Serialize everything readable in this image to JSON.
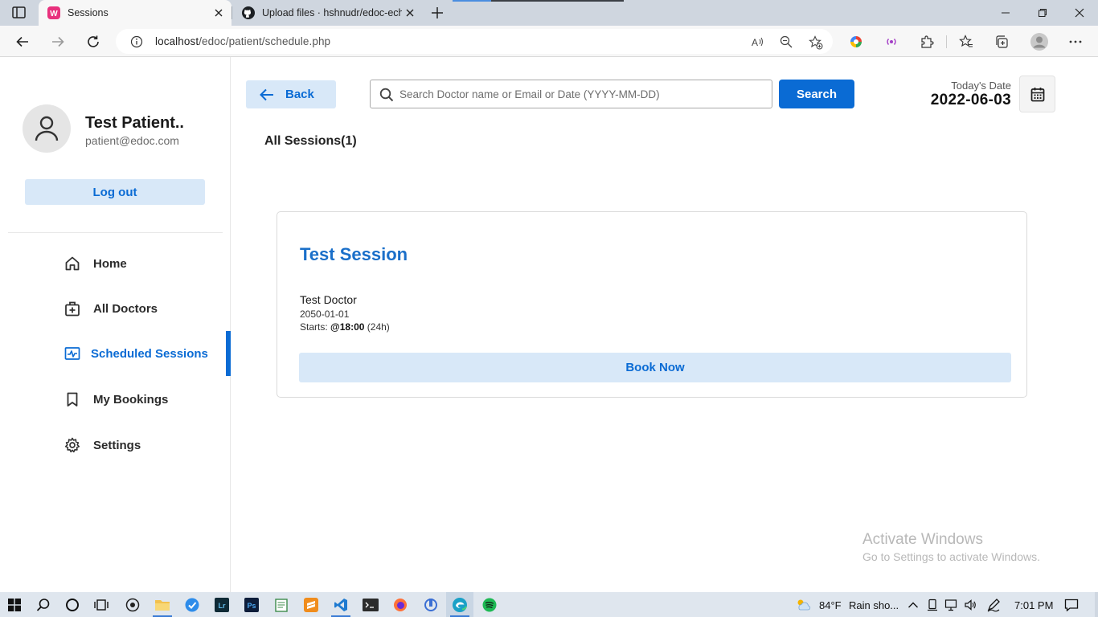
{
  "browser": {
    "tabs": [
      {
        "title": "Sessions",
        "favicon": "wamp-icon",
        "active": true
      },
      {
        "title": "Upload files · hshnudr/edoc-echa",
        "favicon": "github-icon",
        "active": false
      }
    ],
    "url_host": "localhost",
    "url_path": "/edoc/patient/schedule.php"
  },
  "sidebar": {
    "profile": {
      "name": "Test Patient..",
      "email": "patient@edoc.com"
    },
    "logout_label": "Log out",
    "items": [
      {
        "label": "Home",
        "icon": "home-icon"
      },
      {
        "label": "All Doctors",
        "icon": "doctor-bag-icon"
      },
      {
        "label": "Scheduled Sessions",
        "icon": "schedule-icon",
        "active": true
      },
      {
        "label": "My Bookings",
        "icon": "bookmark-icon"
      },
      {
        "label": "Settings",
        "icon": "gear-icon"
      }
    ]
  },
  "header": {
    "back_label": "Back",
    "search_placeholder": "Search Doctor name or Email or Date (YYYY-MM-DD)",
    "search_value": "",
    "search_button": "Search",
    "today_label": "Today's Date",
    "today_value": "2022-06-03"
  },
  "main": {
    "heading": "All Sessions(1)",
    "sessions": [
      {
        "title": "Test Session",
        "doctor": "Test Doctor",
        "date": "2050-01-01",
        "starts_prefix": "Starts:",
        "starts_time": "@18:00",
        "starts_suffix": "(24h)",
        "action_label": "Book Now"
      }
    ]
  },
  "watermark": {
    "line1": "Activate Windows",
    "line2": "Go to Settings to activate Windows."
  },
  "taskbar": {
    "weather": "84°F",
    "weather_text": "Rain sho...",
    "time": "7:01 PM"
  },
  "colors": {
    "accent": "#0a6bd4",
    "accent_light": "#d8e8f8"
  }
}
